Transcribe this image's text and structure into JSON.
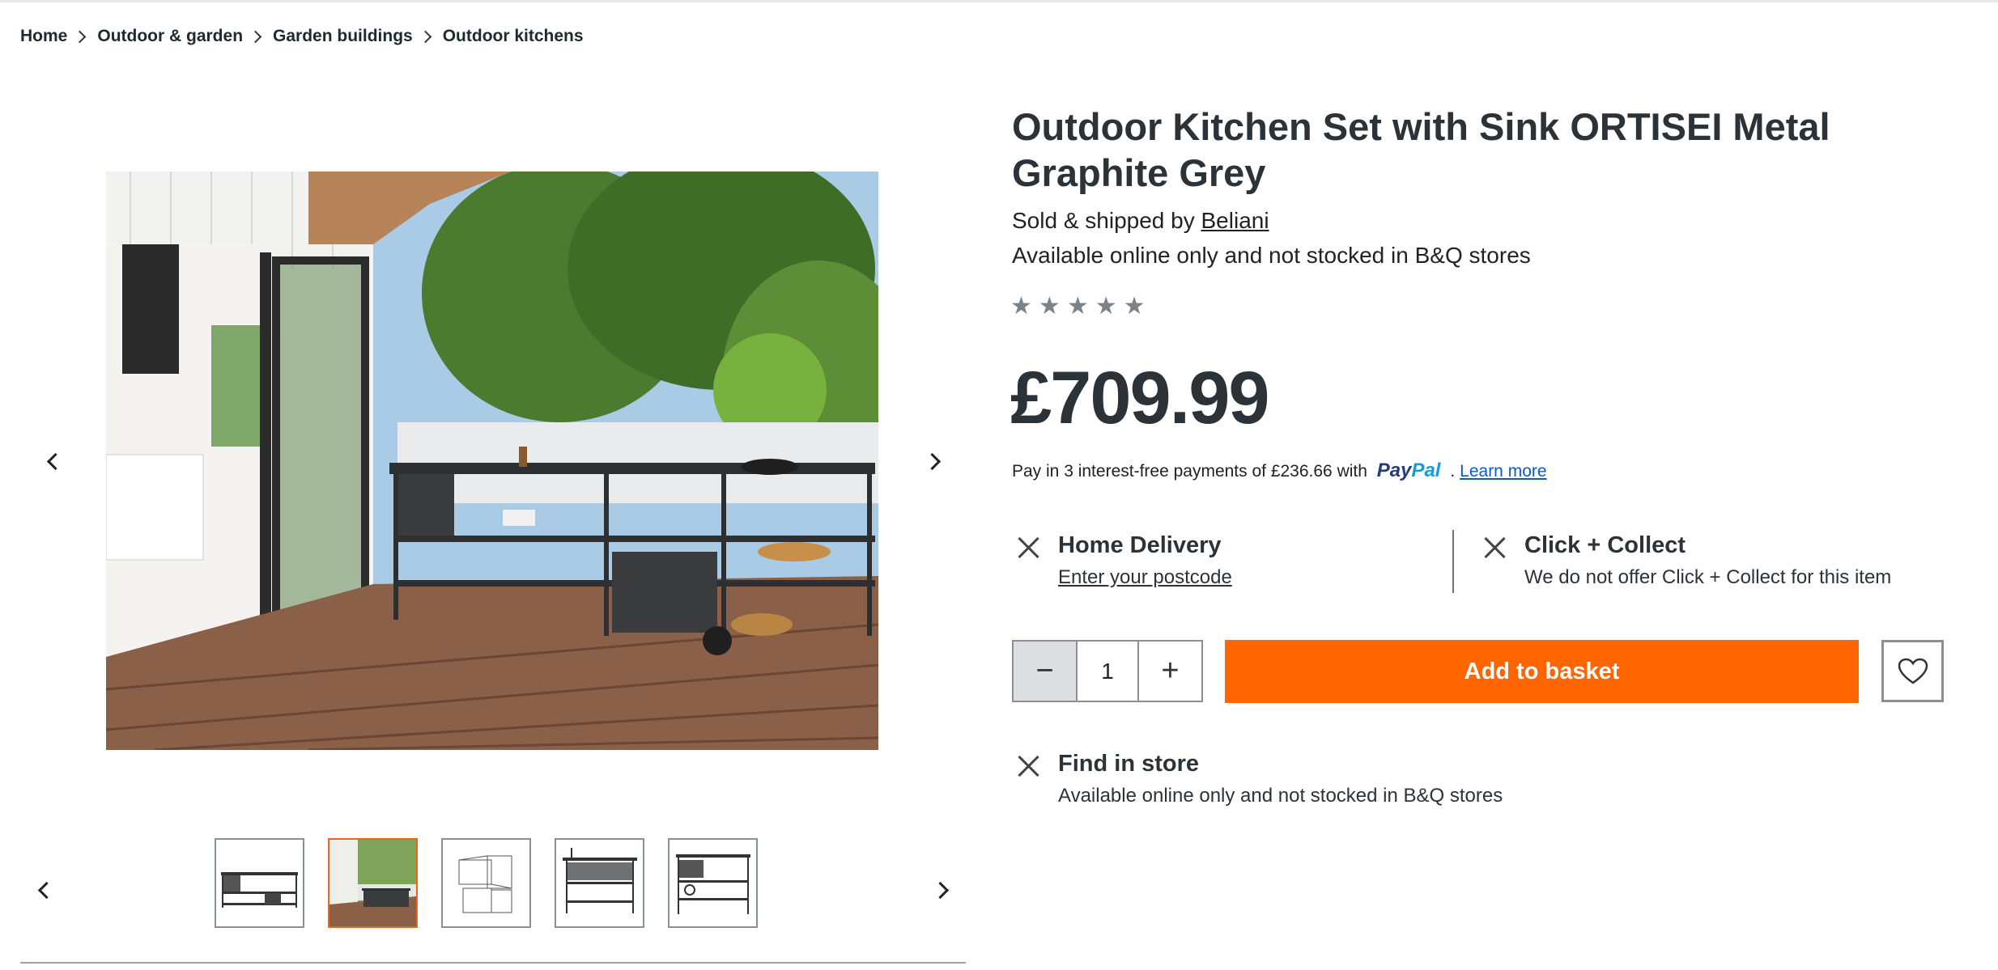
{
  "breadcrumb": [
    "Home",
    "Outdoor & garden",
    "Garden buildings",
    "Outdoor kitchens"
  ],
  "product": {
    "title": "Outdoor Kitchen Set with Sink ORTISEI Metal Graphite Grey",
    "sold_by_prefix": "Sold & shipped by ",
    "seller": "Beliani",
    "availability": "Available online only and not stocked in B&Q stores",
    "rating": 0,
    "rating_max": 5,
    "price": "£709.99"
  },
  "paypal": {
    "text": "Pay in 3 interest-free payments of £236.66 with ",
    "logo_pay": "Pay",
    "logo_pal": "Pal",
    "after": " .",
    "learn_more": "Learn more"
  },
  "fulfilment": {
    "home_delivery": {
      "title": "Home Delivery",
      "link": "Enter your postcode"
    },
    "click_collect": {
      "title": "Click + Collect",
      "text": "We do not offer Click + Collect for this item"
    },
    "find_in_store": {
      "title": "Find in store",
      "text": "Available online only and not stocked in B&Q stores"
    }
  },
  "basket": {
    "quantity": "1",
    "minus": "−",
    "plus": "+",
    "add_label": "Add to basket"
  },
  "gallery": {
    "thumbnail_count": 5,
    "active_thumbnail": 2
  },
  "icons": [
    "chevron-right-icon",
    "chevron-left-icon",
    "close-icon",
    "star-icon",
    "heart-icon"
  ],
  "colors": {
    "accent": "#ff6500",
    "active_thumb": "#f0641e",
    "text": "#2b3338",
    "link": "#0a5cc2"
  }
}
